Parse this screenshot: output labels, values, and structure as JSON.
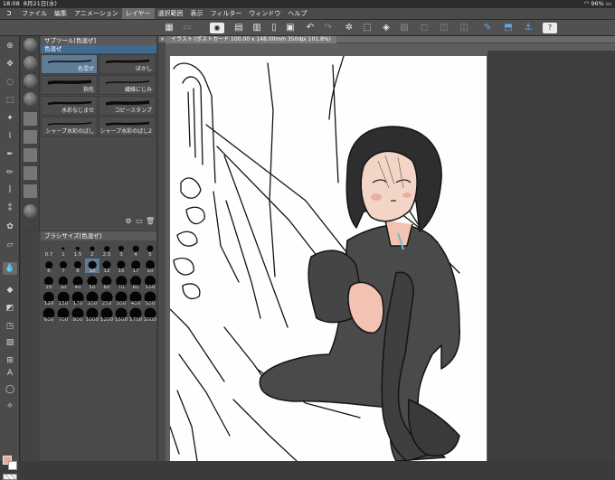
{
  "status_bar": {
    "time": "18:08",
    "date": "8月21日(水)",
    "battery": "96%"
  },
  "menu": [
    "ファイル",
    "編集",
    "アニメーション",
    "レイヤー",
    "選択範囲",
    "表示",
    "フィルター",
    "ウィンドウ",
    "ヘルプ"
  ],
  "menu_active_index": 3,
  "document_tab": {
    "close": "×",
    "title": "イラスト (ポストカード 100.00 x 148.00mm 350dpi 101.8%)"
  },
  "sub_tool": {
    "header": "サブツール[色混ぜ]",
    "group": "色混ぜ",
    "brushes": [
      {
        "label": "色混ぜ",
        "selected": true
      },
      {
        "label": "ぼかし",
        "selected": false
      },
      {
        "label": "指先",
        "selected": false
      },
      {
        "label": "繊維にじみ",
        "selected": false
      },
      {
        "label": "水彩なじませ",
        "selected": false
      },
      {
        "label": "コピースタンプ",
        "selected": false
      },
      {
        "label": "シャープ水彩のばし",
        "selected": false
      },
      {
        "label": "シャープ水彩のばし2",
        "selected": false
      }
    ]
  },
  "brush_size": {
    "header": "ブラシサイズ[色混ぜ]",
    "sizes": [
      "0.7",
      "1",
      "1.5",
      "2",
      "2.5",
      "3",
      "4",
      "5",
      "6",
      "7",
      "8",
      "10",
      "12",
      "15",
      "17",
      "20",
      "25",
      "30",
      "40",
      "50",
      "60",
      "70",
      "80",
      "100",
      "120",
      "150",
      "170",
      "200",
      "250",
      "300",
      "400",
      "500",
      "600",
      "700",
      "800",
      "1000",
      "1200",
      "1500",
      "1700",
      "2000"
    ],
    "selected": "10"
  },
  "colors": {
    "foreground": "#e5a99a",
    "background": "#ffffff",
    "accent_selection": "#5f7c97",
    "skin": "#f2c3b2"
  }
}
